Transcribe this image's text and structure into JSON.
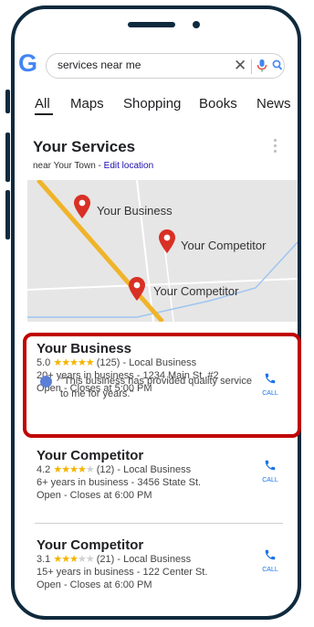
{
  "search": {
    "query": "services near me"
  },
  "tabs": [
    "All",
    "Maps",
    "Shopping",
    "Books",
    "News"
  ],
  "services": {
    "title": "Your Services",
    "location_prefix": "near Your Town - ",
    "edit_location": "Edit location"
  },
  "map": {
    "pins": [
      "Your Business",
      "Your Competitor",
      "Your Competitor"
    ]
  },
  "colors": {
    "accent": "#1a73e8",
    "highlight": "#c00000",
    "star": "#f4b400",
    "pin": "#d93025",
    "road": "#f0b429"
  },
  "listings": [
    {
      "name": "Your Business",
      "rating": "5.0",
      "stars_filled": 5,
      "reviews": "(125) - Local Business",
      "detail": "20+ years in business - 1234 Main St. #2",
      "hours": "Open - Closes at 5:00 PM",
      "review_quote": "\"This business has provided quality service to me for years.\"",
      "call_label": "CALL"
    },
    {
      "name": "Your Competitor",
      "rating": "4.2",
      "stars_filled": 4,
      "reviews": "(12) - Local Business",
      "detail": "6+ years in business - 3456 State St.",
      "hours": "Open - Closes at 6:00 PM",
      "call_label": "CALL"
    },
    {
      "name": "Your Competitor",
      "rating": "3.1",
      "stars_filled": 3,
      "reviews": "(21) - Local Business",
      "detail": "15+ years in business - 122 Center St.",
      "hours": "Open - Closes at 6:00 PM",
      "call_label": "CALL"
    }
  ]
}
